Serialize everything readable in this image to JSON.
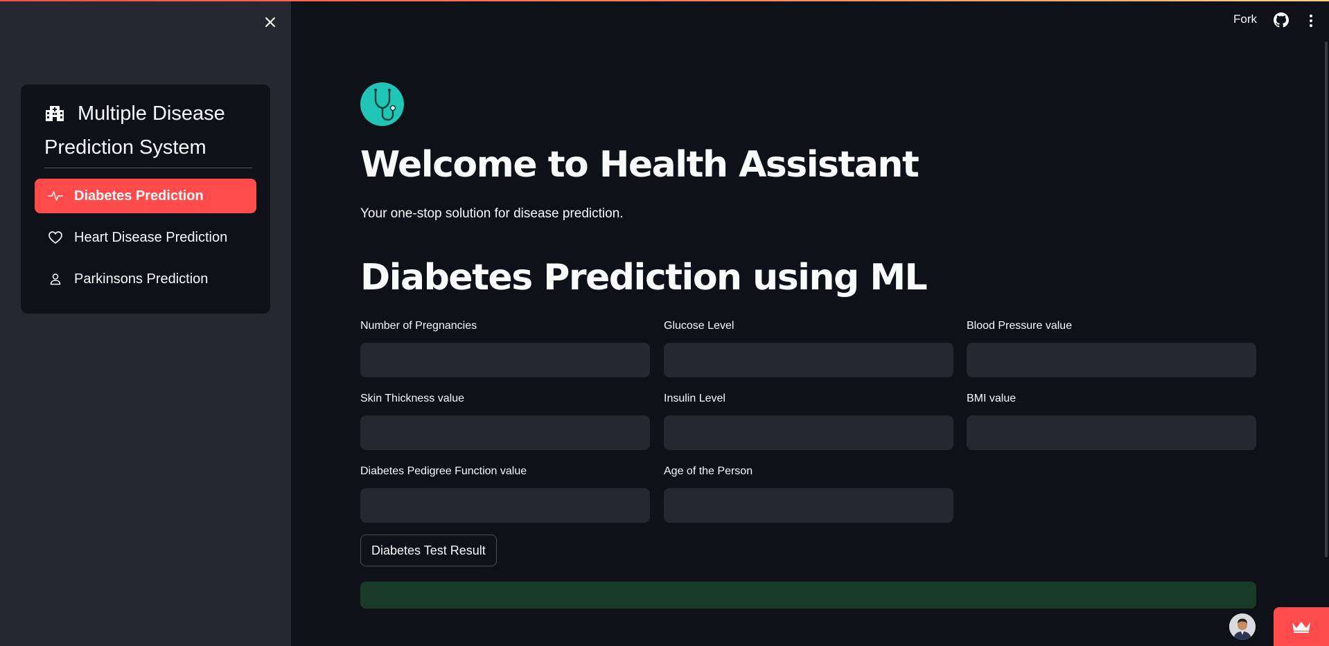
{
  "header": {
    "fork_label": "Fork",
    "github_icon": "github-icon",
    "menu_icon": "kebab-menu-icon"
  },
  "sidebar": {
    "close_icon": "close-icon",
    "title": "Multiple Disease Prediction System",
    "title_icon": "hospital-icon",
    "items": [
      {
        "label": "Diabetes Prediction",
        "icon": "activity-icon",
        "active": true
      },
      {
        "label": "Heart Disease Prediction",
        "icon": "heart-icon",
        "active": false
      },
      {
        "label": "Parkinsons Prediction",
        "icon": "person-icon",
        "active": false
      }
    ]
  },
  "main": {
    "logo_icon": "stethoscope-icon",
    "welcome_title": "Welcome to Health Assistant",
    "tagline": "Your one-stop solution for disease prediction.",
    "section_title": "Diabetes Prediction using ML",
    "fields": [
      {
        "label": "Number of Pregnancies",
        "value": ""
      },
      {
        "label": "Glucose Level",
        "value": ""
      },
      {
        "label": "Blood Pressure value",
        "value": ""
      },
      {
        "label": "Skin Thickness value",
        "value": ""
      },
      {
        "label": "Insulin Level",
        "value": ""
      },
      {
        "label": "BMI value",
        "value": ""
      },
      {
        "label": "Diabetes Pedigree Function value",
        "value": ""
      },
      {
        "label": "Age of the Person",
        "value": ""
      }
    ],
    "submit_label": "Diabetes Test Result",
    "result_text": ""
  },
  "colors": {
    "accent": "#ff4b4b",
    "background": "#0e1117",
    "sidebar_bg": "#262730",
    "logo_bg": "#20c5b5",
    "result_bg": "#1a3a28"
  }
}
